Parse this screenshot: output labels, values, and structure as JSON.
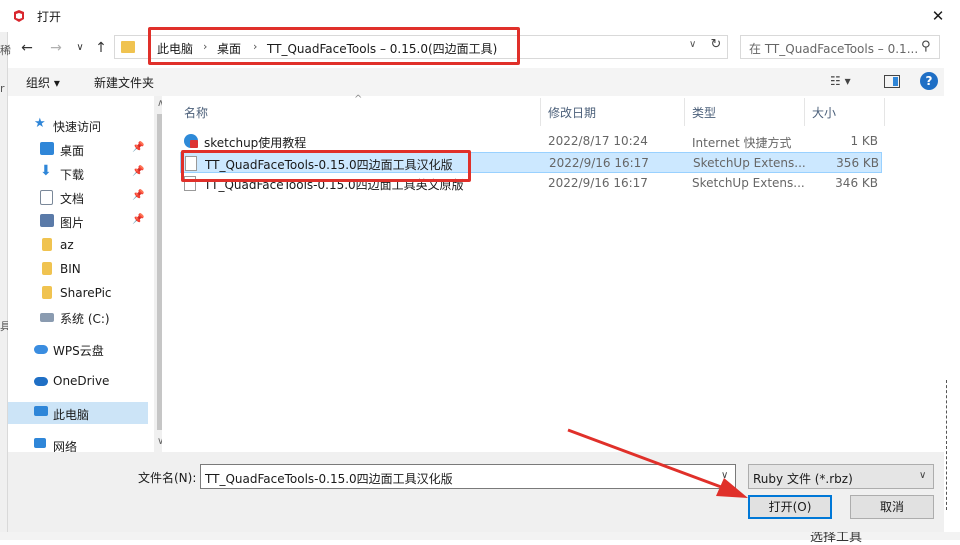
{
  "window": {
    "title": "打开",
    "close_glyph": "✕"
  },
  "address": {
    "crumbs": [
      "此电脑",
      "桌面",
      "TT_QuadFaceTools – 0.15.0(四边面工具)"
    ],
    "separator": "›",
    "dropdown_glyph": "∨",
    "refresh_glyph": "↻"
  },
  "search": {
    "placeholder": "在 TT_QuadFaceTools – 0.1...",
    "icon_glyph": "⚲"
  },
  "nav_glyphs": {
    "back": "←",
    "forward": "→",
    "recent": "∨",
    "up": "↑"
  },
  "toolbar": {
    "organize": "组织 ▾",
    "new_folder": "新建文件夹",
    "view_glyph": "☷ ▾",
    "help_glyph": "?"
  },
  "sidebar": {
    "items": [
      {
        "label": "快速访问",
        "icon": "star-icon",
        "color": "#2f86d8"
      },
      {
        "label": "桌面",
        "icon": "desktop-icon",
        "color": "#2f86d8",
        "pinned": true
      },
      {
        "label": "下载",
        "icon": "download-icon",
        "color": "#2f86d8",
        "pinned": true
      },
      {
        "label": "文档",
        "icon": "document-icon",
        "color": "#7a8899",
        "pinned": true
      },
      {
        "label": "图片",
        "icon": "pictures-icon",
        "color": "#5a7aa8",
        "pinned": true
      },
      {
        "label": "az",
        "icon": "folder-icon",
        "color": "#f0c350"
      },
      {
        "label": "BIN",
        "icon": "folder-icon",
        "color": "#f0c350"
      },
      {
        "label": "SharePic",
        "icon": "folder-icon",
        "color": "#f0c350"
      },
      {
        "label": "系统 (C:)",
        "icon": "drive-icon",
        "color": "#8a9bb0"
      },
      {
        "label": "WPS云盘",
        "icon": "cloud-icon",
        "color": "#3a8de0"
      },
      {
        "label": "OneDrive",
        "icon": "cloud-icon",
        "color": "#1f6fc5"
      },
      {
        "label": "此电脑",
        "icon": "computer-icon",
        "color": "#2f86d8",
        "selected": true
      },
      {
        "label": "网络",
        "icon": "network-icon",
        "color": "#2f86d8"
      }
    ],
    "pin_glyph": "📌",
    "scroll_up": "∧",
    "scroll_down": "∨"
  },
  "file_list": {
    "columns": [
      "名称",
      "修改日期",
      "类型",
      "大小"
    ],
    "sort_glyph": "^",
    "rows": [
      {
        "name": "sketchup使用教程",
        "date": "2022/8/17 10:24",
        "type": "Internet 快捷方式",
        "size": "1 KB",
        "icon": "web-shortcut-icon"
      },
      {
        "name": "TT_QuadFaceTools-0.15.0四边面工具汉化版",
        "date": "2022/9/16 16:17",
        "type": "SketchUp Extens...",
        "size": "356 KB",
        "icon": "file-icon",
        "selected": true
      },
      {
        "name": "TT_QuadFaceTools-0.15.0四边面工具英文原版",
        "date": "2022/9/16 16:17",
        "type": "SketchUp Extens...",
        "size": "346 KB",
        "icon": "file-icon"
      }
    ]
  },
  "bottom": {
    "filename_label": "文件名(N):",
    "filename_value": "TT_QuadFaceTools-0.15.0四边面工具汉化版",
    "filetype_value": "Ruby 文件 (*.rbz)",
    "dropdown_glyph": "∨",
    "open_label": "打开(O)",
    "cancel_label": "取消"
  },
  "background": {
    "left_chars": [
      "稀",
      "r",
      "具"
    ],
    "bottom_text": "选择工具"
  },
  "colors": {
    "annotation_red": "#e0302a",
    "selection": "#cce8ff",
    "accent": "#0078d7"
  }
}
